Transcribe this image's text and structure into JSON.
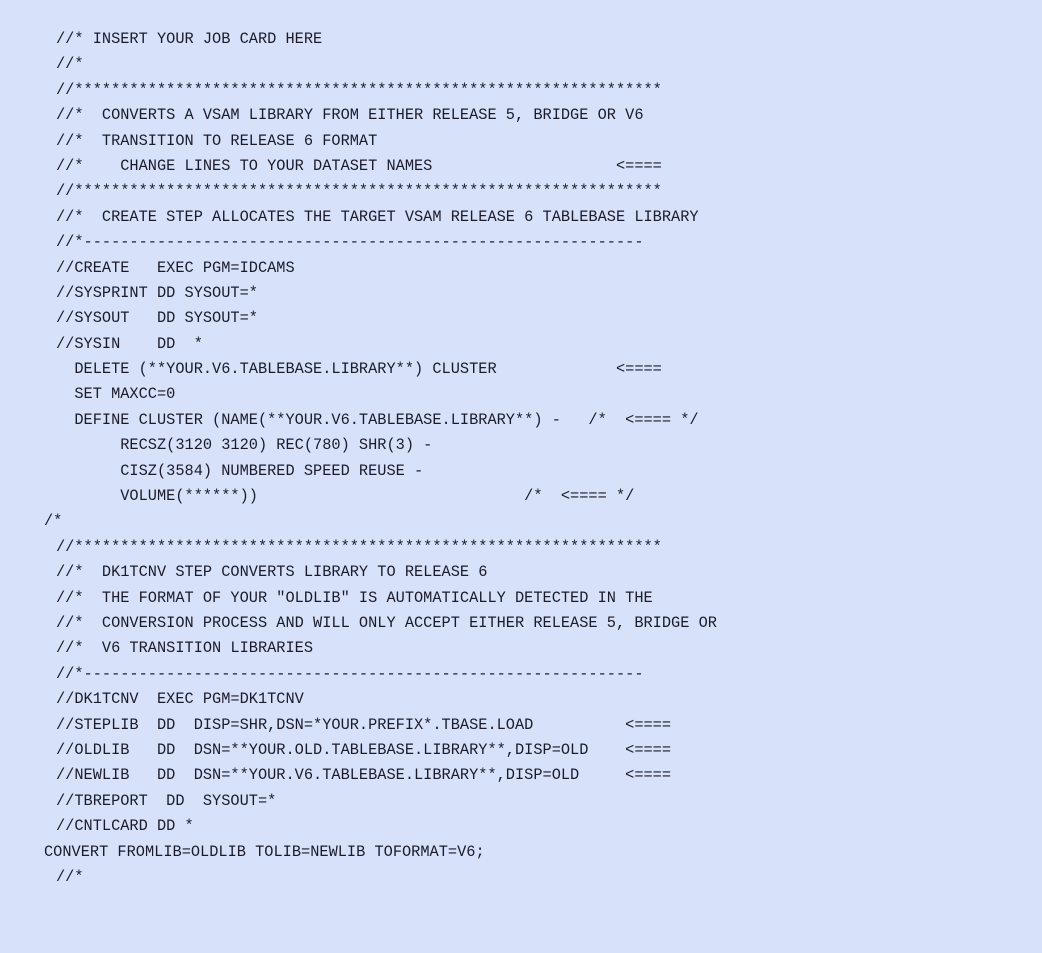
{
  "document": {
    "kind": "jcl-source-listing",
    "background_color": "#d7e1f9",
    "text_color": "#1b1b2b",
    "font_style": "monospace",
    "line_count": 35
  },
  "lines": [
    {
      "indent": "normal",
      "text": "//* INSERT YOUR JOB CARD HERE"
    },
    {
      "indent": "normal",
      "text": "//*"
    },
    {
      "indent": "normal",
      "text": "//****************************************************************"
    },
    {
      "indent": "normal",
      "text": "//*  CONVERTS A VSAM LIBRARY FROM EITHER RELEASE 5, BRIDGE OR V6"
    },
    {
      "indent": "normal",
      "text": "//*  TRANSITION TO RELEASE 6 FORMAT"
    },
    {
      "indent": "normal",
      "text": "//*    CHANGE LINES TO YOUR DATASET NAMES                    <===="
    },
    {
      "indent": "normal",
      "text": "//****************************************************************"
    },
    {
      "indent": "normal",
      "text": "//*  CREATE STEP ALLOCATES THE TARGET VSAM RELEASE 6 TABLEBASE LIBRARY"
    },
    {
      "indent": "normal",
      "text": "//*-------------------------------------------------------------"
    },
    {
      "indent": "normal",
      "text": "//CREATE   EXEC PGM=IDCAMS"
    },
    {
      "indent": "normal",
      "text": "//SYSPRINT DD SYSOUT=*"
    },
    {
      "indent": "normal",
      "text": "//SYSOUT   DD SYSOUT=*"
    },
    {
      "indent": "normal",
      "text": "//SYSIN    DD  *"
    },
    {
      "indent": "normal",
      "text": "  DELETE (**YOUR.V6.TABLEBASE.LIBRARY**) CLUSTER             <===="
    },
    {
      "indent": "normal",
      "text": "  SET MAXCC=0"
    },
    {
      "indent": "normal",
      "text": "  DEFINE CLUSTER (NAME(**YOUR.V6.TABLEBASE.LIBRARY**) -   /*  <==== */"
    },
    {
      "indent": "normal",
      "text": "       RECSZ(3120 3120) REC(780) SHR(3) -"
    },
    {
      "indent": "normal",
      "text": "       CISZ(3584) NUMBERED SPEED REUSE -"
    },
    {
      "indent": "normal",
      "text": "       VOLUME(******))                             /*  <==== */"
    },
    {
      "indent": "flush",
      "text": "/*"
    },
    {
      "indent": "normal",
      "text": "//****************************************************************"
    },
    {
      "indent": "normal",
      "text": "//*  DK1TCNV STEP CONVERTS LIBRARY TO RELEASE 6"
    },
    {
      "indent": "normal",
      "text": "//*  THE FORMAT OF YOUR \"OLDLIB\" IS AUTOMATICALLY DETECTED IN THE"
    },
    {
      "indent": "normal",
      "text": "//*  CONVERSION PROCESS AND WILL ONLY ACCEPT EITHER RELEASE 5, BRIDGE OR"
    },
    {
      "indent": "normal",
      "text": "//*  V6 TRANSITION LIBRARIES"
    },
    {
      "indent": "normal",
      "text": "//*-------------------------------------------------------------"
    },
    {
      "indent": "normal",
      "text": "//DK1TCNV  EXEC PGM=DK1TCNV"
    },
    {
      "indent": "normal",
      "text": "//STEPLIB  DD  DISP=SHR,DSN=*YOUR.PREFIX*.TBASE.LOAD          <===="
    },
    {
      "indent": "normal",
      "text": "//OLDLIB   DD  DSN=**YOUR.OLD.TABLEBASE.LIBRARY**,DISP=OLD    <===="
    },
    {
      "indent": "normal",
      "text": "//NEWLIB   DD  DSN=**YOUR.V6.TABLEBASE.LIBRARY**,DISP=OLD     <===="
    },
    {
      "indent": "normal",
      "text": "//TBREPORT  DD  SYSOUT=*"
    },
    {
      "indent": "normal",
      "text": "//CNTLCARD DD *"
    },
    {
      "indent": "flush",
      "text": "CONVERT FROMLIB=OLDLIB TOLIB=NEWLIB TOFORMAT=V6;"
    },
    {
      "indent": "normal",
      "text": "//*"
    }
  ]
}
